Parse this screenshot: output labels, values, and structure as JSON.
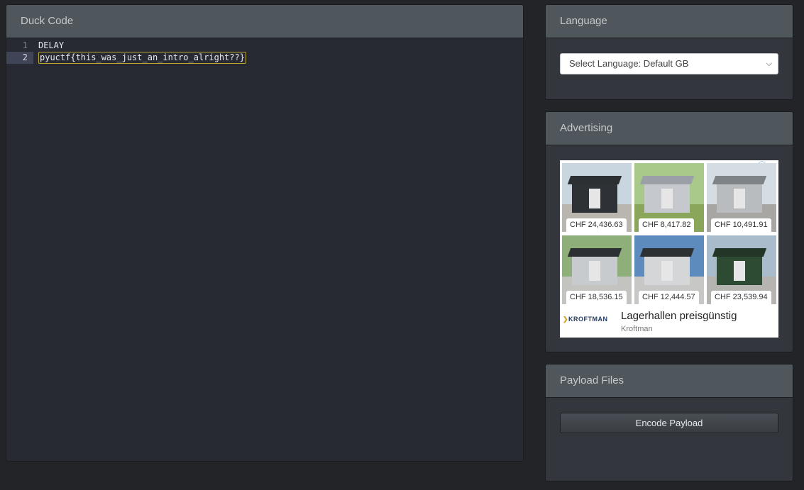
{
  "code_panel": {
    "title": "Duck Code",
    "lines": [
      {
        "num": "1",
        "text": "DELAY"
      },
      {
        "num": "2",
        "text": "pyuctf{this_was_just_an_intro_alright??}"
      }
    ]
  },
  "language_panel": {
    "title": "Language",
    "select_value": "Select Language: Default GB"
  },
  "ad_panel": {
    "title": "Advertising",
    "prices": [
      "CHF 24,436.63",
      "CHF 8,417.82",
      "CHF 10,491.91",
      "CHF 18,536.15",
      "CHF 12,444.57",
      "CHF 23,539.94"
    ],
    "brand": "KROFTMAN",
    "headline": "Lagerhallen preisgünstig",
    "advertiser": "Kroftman"
  },
  "payload_panel": {
    "title": "Payload Files",
    "encode_label": "Encode Payload"
  }
}
